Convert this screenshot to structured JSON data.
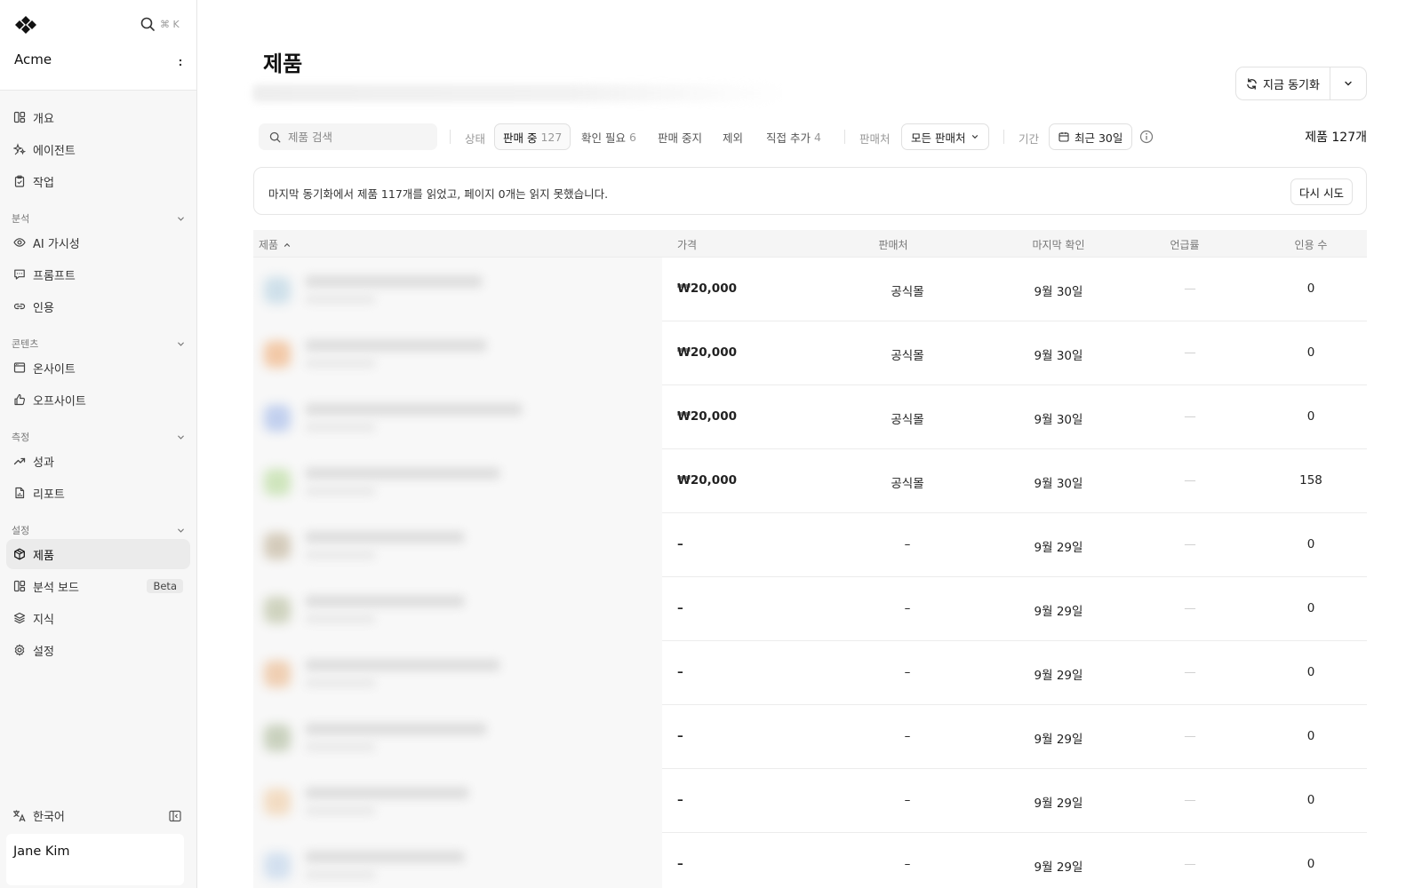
{
  "sidebar": {
    "org_name": "Acme",
    "search_shortcut": "⌘ K",
    "top_items": [
      {
        "label": "개요",
        "icon": "layout-icon"
      },
      {
        "label": "에이전트",
        "icon": "sparkles-icon"
      },
      {
        "label": "작업",
        "icon": "clipboard-icon"
      }
    ],
    "sections": [
      {
        "title": "분석",
        "items": [
          {
            "label": "AI 가시성",
            "icon": "eye-icon"
          },
          {
            "label": "프롬프트",
            "icon": "message-icon"
          },
          {
            "label": "인용",
            "icon": "link-icon"
          }
        ]
      },
      {
        "title": "콘텐츠",
        "items": [
          {
            "label": "온사이트",
            "icon": "browser-icon"
          },
          {
            "label": "오프사이트",
            "icon": "thumbs-up-icon"
          }
        ]
      },
      {
        "title": "측정",
        "items": [
          {
            "label": "성과",
            "icon": "trending-up-icon"
          },
          {
            "label": "리포트",
            "icon": "file-chart-icon"
          }
        ]
      },
      {
        "title": "설정",
        "items": [
          {
            "label": "제품",
            "icon": "package-icon",
            "active": true
          },
          {
            "label": "분석 보드",
            "icon": "layout-icon",
            "badge": "Beta"
          },
          {
            "label": "지식",
            "icon": "layers-icon"
          },
          {
            "label": "설정",
            "icon": "gear-icon"
          }
        ]
      }
    ],
    "language": "한국어",
    "user_name": "Jane Kim"
  },
  "main": {
    "title": "제품",
    "sync_button": "지금 동기화",
    "search_placeholder": "제품 검색",
    "filters": {
      "status_label": "상태",
      "status_pills": [
        {
          "label": "판매 중",
          "count": "127",
          "active": true
        },
        {
          "label": "확인 필요",
          "count": "6"
        },
        {
          "label": "판매 중지",
          "count": ""
        },
        {
          "label": "제외",
          "count": ""
        },
        {
          "label": "직접 추가",
          "count": "4"
        }
      ],
      "seller_label": "판매처",
      "seller_value": "모든 판매처",
      "period_label": "기간",
      "period_value": "최근 30일"
    },
    "total_count": "제품 127개",
    "notice": {
      "text": "마지막 동기화에서 제품 117개를 읽었고, 페이지 0개는 읽지 못했습니다.",
      "retry_label": "다시 시도"
    },
    "table": {
      "headers": {
        "product": "제품",
        "price": "가격",
        "seller": "판매처",
        "last_checked": "마지막 확인",
        "mention_rate": "언급률",
        "citations": "인용 수"
      },
      "rows": [
        {
          "price": "₩20,000",
          "seller": "공식몰",
          "last_checked": "9월 30일",
          "mention_rate": "—",
          "citations": "0",
          "thumb_color": "#cfe0ea"
        },
        {
          "price": "₩20,000",
          "seller": "공식몰",
          "last_checked": "9월 30일",
          "mention_rate": "—",
          "citations": "0",
          "thumb_color": "#f2c9a8"
        },
        {
          "price": "₩20,000",
          "seller": "공식몰",
          "last_checked": "9월 30일",
          "mention_rate": "—",
          "citations": "0",
          "thumb_color": "#c2d0ee"
        },
        {
          "price": "₩20,000",
          "seller": "공식몰",
          "last_checked": "9월 30일",
          "mention_rate": "—",
          "citations": "158",
          "thumb_color": "#cfe5bd"
        },
        {
          "price": "–",
          "seller": "–",
          "last_checked": "9월 29일",
          "mention_rate": "—",
          "citations": "0",
          "thumb_color": "#d4cbbb"
        },
        {
          "price": "–",
          "seller": "–",
          "last_checked": "9월 29일",
          "mention_rate": "—",
          "citations": "0",
          "thumb_color": "#cfd3bf"
        },
        {
          "price": "–",
          "seller": "–",
          "last_checked": "9월 29일",
          "mention_rate": "—",
          "citations": "0",
          "thumb_color": "#efcfb3"
        },
        {
          "price": "–",
          "seller": "–",
          "last_checked": "9월 29일",
          "mention_rate": "—",
          "citations": "0",
          "thumb_color": "#c9d1be"
        },
        {
          "price": "–",
          "seller": "–",
          "last_checked": "9월 29일",
          "mention_rate": "—",
          "citations": "0",
          "thumb_color": "#f2dcc3"
        },
        {
          "price": "–",
          "seller": "–",
          "last_checked": "9월 29일",
          "mention_rate": "—",
          "citations": "0",
          "thumb_color": "#d3e0ef"
        }
      ]
    }
  }
}
